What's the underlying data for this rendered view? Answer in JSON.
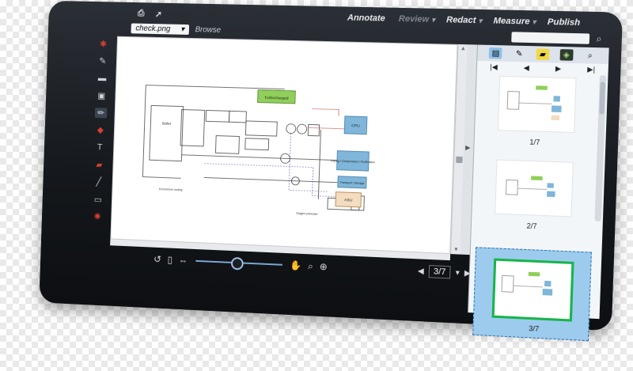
{
  "topbar": {
    "menu": [
      {
        "label": "Annotate",
        "disabled": false,
        "caret": ""
      },
      {
        "label": "Review",
        "disabled": true,
        "caret": "▾"
      },
      {
        "label": "Redact",
        "disabled": false,
        "caret": "▾"
      },
      {
        "label": "Measure",
        "disabled": false,
        "caret": "▾"
      },
      {
        "label": "Publish",
        "disabled": false,
        "caret": ""
      }
    ]
  },
  "addressbar": {
    "file": "check.png",
    "browse": "Browse"
  },
  "diagram": {
    "title_box": "Turbocharged",
    "left_block": "Boiler",
    "cpu_box": "CPU",
    "right_box_1": "Drying / Compression / Purification",
    "right_box_2": "Transport / Storage",
    "asu_box": "ASU",
    "label_bottom_left": "Economizer cooling",
    "label_bottom_mid": "Oxygen preheater"
  },
  "bottombar": {
    "page_value": "3/7"
  },
  "thumbnails": [
    {
      "label": "1/7"
    },
    {
      "label": "2/7"
    },
    {
      "label": "3/7"
    }
  ],
  "colors": {
    "accent": "#8fc0ea",
    "selection_border": "#17b54b",
    "diagram_blue": "#7fb6d9",
    "diagram_green": "#8fcf5a"
  }
}
